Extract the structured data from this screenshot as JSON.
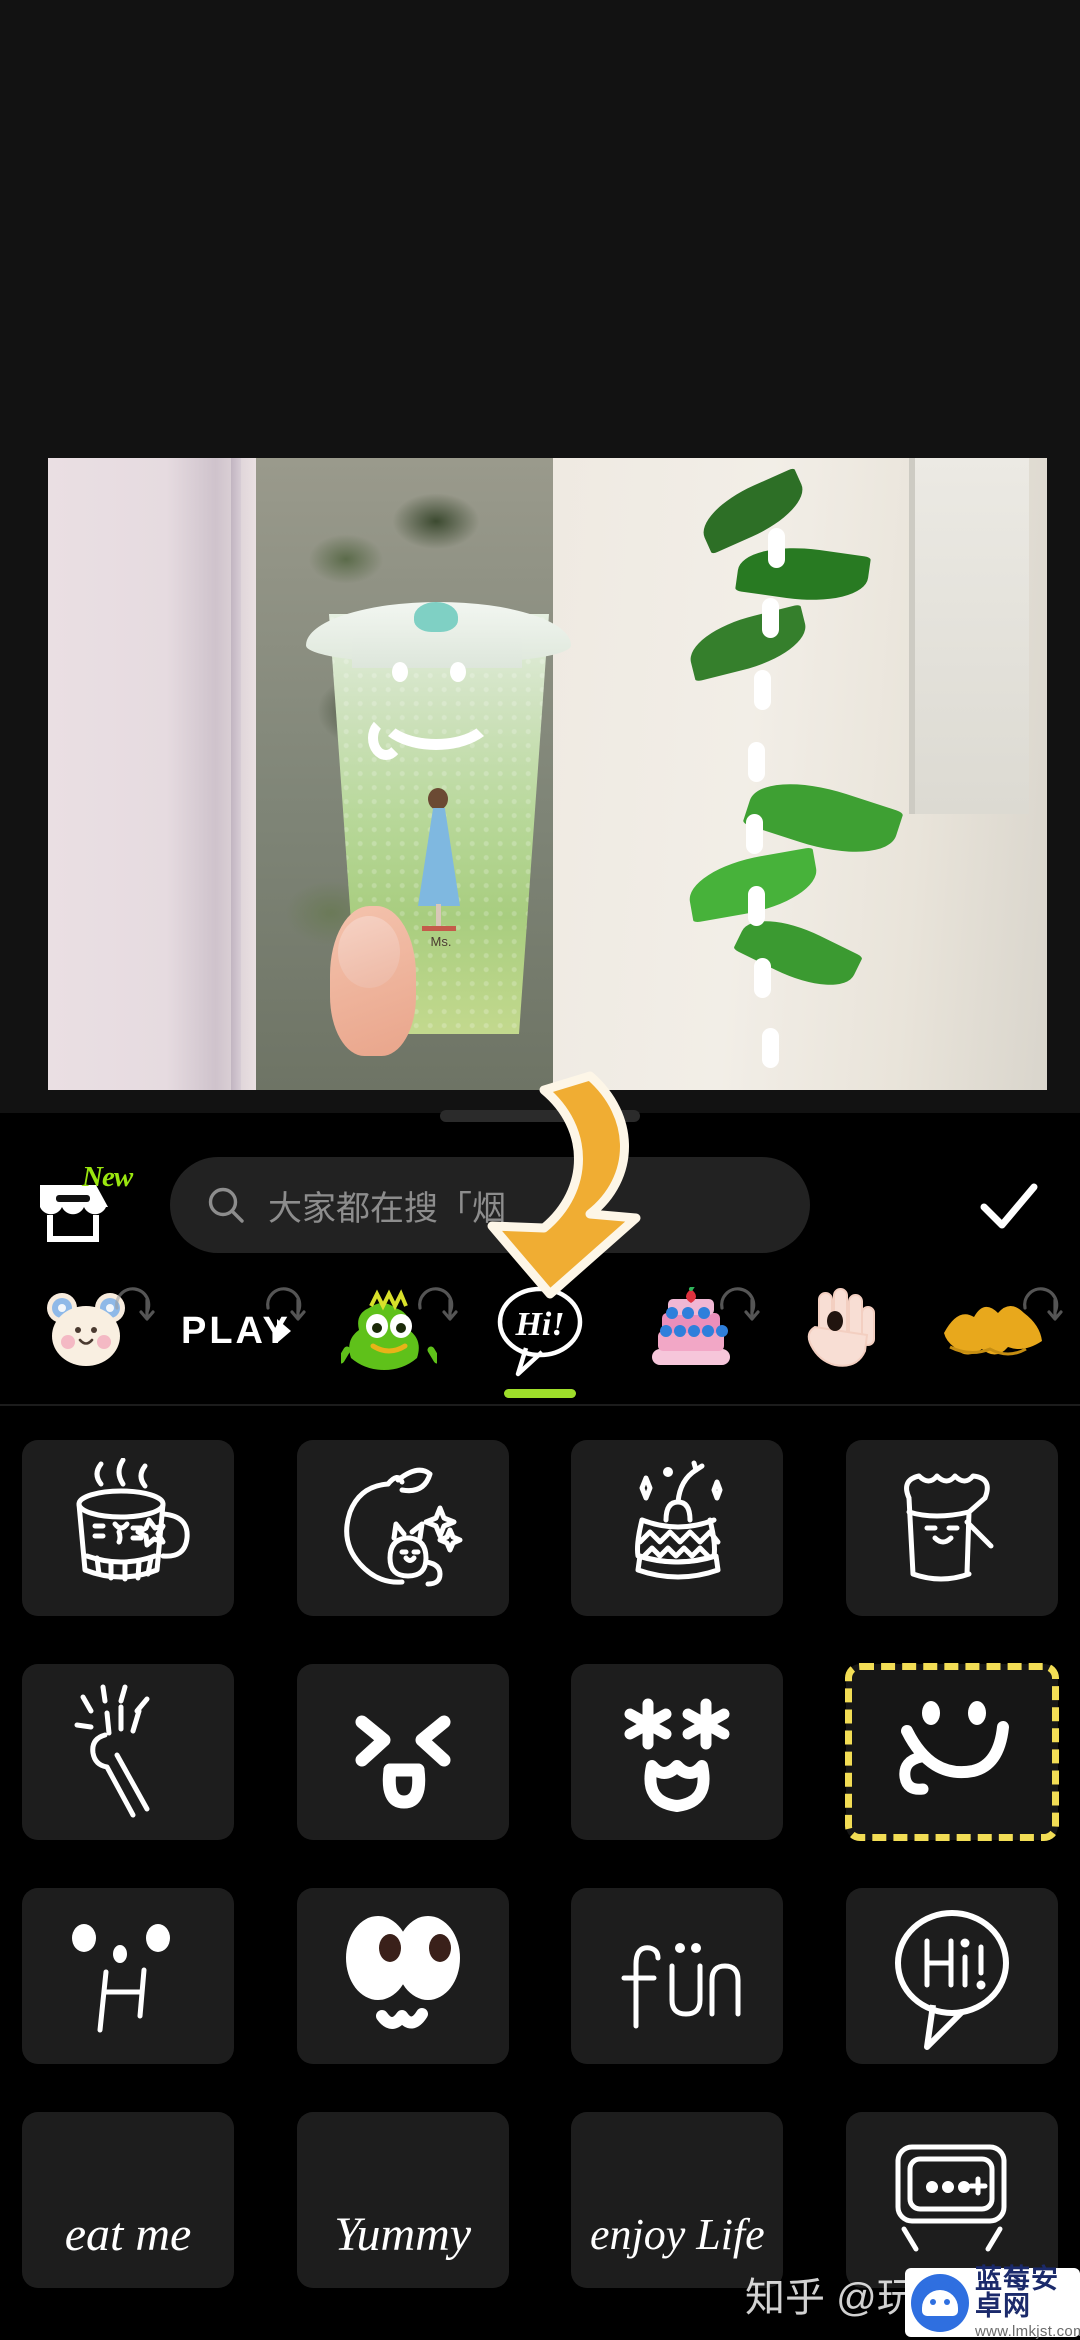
{
  "app": {
    "mode": "sticker-picker",
    "accent_green": "#9ede2a",
    "selection_yellow": "#f2dd55",
    "arrow_color": "#f0ad33",
    "sheet_bg": "#000000",
    "tile_bg": "#1d1d1d"
  },
  "editor": {
    "photo_description": "hand holding iced matcha drink in plastic cup near window with plants",
    "applied_sticker_label": "Ms.",
    "drag_handle": "sheet-drag-handle"
  },
  "toolbar": {
    "store_icon": "storefront-icon",
    "store_badge": "New",
    "confirm_icon": "check-icon"
  },
  "search": {
    "icon": "search-icon",
    "placeholder": "大家都在搜「烟",
    "value": ""
  },
  "tabs": {
    "active_index": 3,
    "items": [
      {
        "name": "tab-fluffy-bear",
        "icon": "fluffy-bear-icon",
        "label": "",
        "downloadable": true
      },
      {
        "name": "tab-play",
        "icon": "play-text-icon",
        "label": "PLAY",
        "downloadable": true
      },
      {
        "name": "tab-green-monster",
        "icon": "green-monster-icon",
        "label": "",
        "downloadable": true
      },
      {
        "name": "tab-hi-bubble",
        "icon": "hi-speech-bubble-icon",
        "label": "Hi!",
        "downloadable": false
      },
      {
        "name": "tab-birthday-cake",
        "icon": "birthday-cake-icon",
        "label": "",
        "downloadable": true
      },
      {
        "name": "tab-hand-wave",
        "icon": "hand-wave-icon",
        "label": "",
        "downloadable": false
      },
      {
        "name": "tab-yellow-brush",
        "icon": "yellow-brush-icon",
        "label": "",
        "downloadable": true
      }
    ]
  },
  "sticker_grid": {
    "columns": 4,
    "selected_id": "smiley-tongue",
    "items": [
      {
        "id": "mug-face",
        "name": "sticker-mug-with-face",
        "label": ""
      },
      {
        "id": "apple-cat",
        "name": "sticker-apple-with-cat",
        "label": ""
      },
      {
        "id": "cake-cherry",
        "name": "sticker-cake-with-cherry",
        "label": ""
      },
      {
        "id": "bread-cat",
        "name": "sticker-bread-cat",
        "label": ""
      },
      {
        "id": "snap-hand",
        "name": "sticker-snapping-hand",
        "label": ""
      },
      {
        "id": "face-xux",
        "name": "sticker-face-squint-smile",
        "label": ""
      },
      {
        "id": "face-stars",
        "name": "sticker-face-star-eyes",
        "label": ""
      },
      {
        "id": "smiley-tongue",
        "name": "sticker-smiley-tongue",
        "label": ""
      },
      {
        "id": "face-sad",
        "name": "sticker-face-simple-sad",
        "label": ""
      },
      {
        "id": "big-eyes",
        "name": "sticker-big-cartoon-eyes",
        "label": ""
      },
      {
        "id": "fun-text",
        "name": "sticker-text-fun",
        "label": "fün"
      },
      {
        "id": "hi-bubble",
        "name": "sticker-hi-speech-bubble",
        "label": "Hi!"
      },
      {
        "id": "eat-me",
        "name": "sticker-text-eat-me",
        "label": "eat me"
      },
      {
        "id": "yummy",
        "name": "sticker-text-yummy",
        "label": "Yummy"
      },
      {
        "id": "enjoy-life",
        "name": "sticker-text-enjoy-life",
        "label": "enjoy Life"
      },
      {
        "id": "camera",
        "name": "sticker-camera",
        "label": ""
      }
    ]
  },
  "annotation": {
    "arrow": "curved-down-arrow",
    "arrow_points_to": "sticker-grid"
  },
  "watermarks": {
    "zhihu": "知乎 @玩",
    "site_cn": "蓝莓安卓网",
    "site_url": "www.lmkjst.com"
  }
}
